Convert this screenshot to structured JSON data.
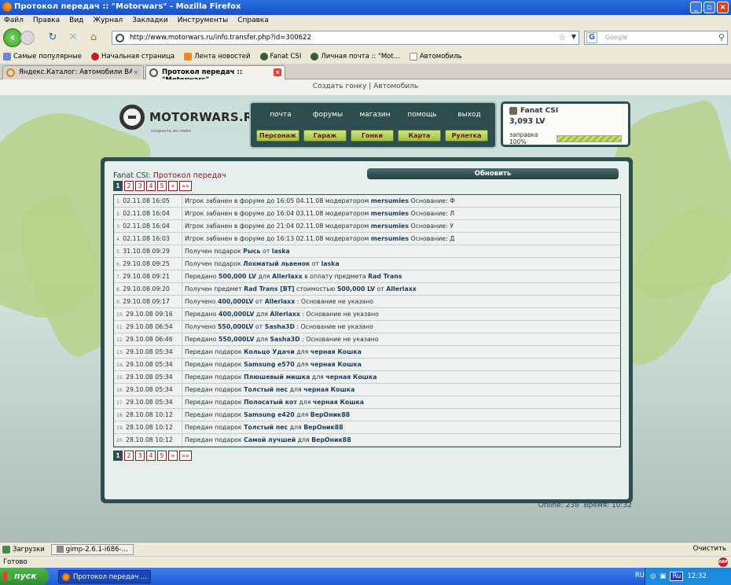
{
  "window": {
    "title": "Протокол передач :: \"Motorwars\" - Mozilla Firefox"
  },
  "menu": [
    "Файл",
    "Правка",
    "Вид",
    "Журнал",
    "Закладки",
    "Инструменты",
    "Справка"
  ],
  "nav": {
    "url": "http://www.motorwars.ru/info.transfer.php?id=300622",
    "search_placeholder": "Google"
  },
  "bookmarks": [
    "Самые популярные",
    "Начальная страница",
    "Лента новостей",
    "Fanat CSI",
    "Личная почта :: \"Mot...",
    "Автомобиль"
  ],
  "tabs": [
    {
      "label": "Яндекс.Каталог: Автомобили ВАЗ",
      "active": false
    },
    {
      "label": "Протокол передач :: \"Motorwars\"",
      "active": true
    }
  ],
  "site": {
    "top_links": "Создать гонку | Автомобиль",
    "logo_text": "MOTORWARS.RU",
    "logo_sub": "скорость он-лайн",
    "nav_top": [
      "почта",
      "форумы",
      "магазин",
      "помощь",
      "выход"
    ],
    "nav_buttons": [
      "Персонаж",
      "Гараж",
      "Гонки",
      "Карта",
      "Рулетка"
    ],
    "user": {
      "name": "Fanat CSI",
      "lv": "3,093 LV",
      "fuel_label": "заправка 100%",
      "fuel": 1.0
    },
    "panel_user": "Fanat CSI",
    "panel_title": ": Протокол передач",
    "refresh": "Обновить",
    "pages": [
      "1",
      "2",
      "3",
      "4",
      "5",
      "»",
      "»»"
    ],
    "online": "Online: 238",
    "time": "Время: 10:32"
  },
  "log": [
    {
      "n": "1.",
      "date": "02.11.08 16:05",
      "pre": "Игрок забанен в форуме до 16:05 04.11.08 модератором ",
      "b1": "mersumies",
      "post": " Основание: Ф"
    },
    {
      "n": "2.",
      "date": "02.11.08 16:04",
      "pre": "Игрок забанен в форуме до 16:04 03.11.08 модератором ",
      "b1": "mersumies",
      "post": " Основание: Л"
    },
    {
      "n": "3.",
      "date": "02.11.08 16:04",
      "pre": "Игрок забанен в форуме до 21:04 02.11.08 модератором ",
      "b1": "mersumies",
      "post": " Основание: У"
    },
    {
      "n": "4.",
      "date": "02.11.08 16:03",
      "pre": "Игрок забанен в форуме до 16:13 02.11.08 модератором ",
      "b1": "mersumies",
      "post": " Основание: Д"
    },
    {
      "n": "5.",
      "date": "31.10.08 09:29",
      "pre": "Получен подарок ",
      "b1": "Рысь",
      "post": " от ",
      "b2": "laska"
    },
    {
      "n": "6.",
      "date": "29.10.08 09:25",
      "pre": "Получен подарок ",
      "b1": "Лохматый львенок",
      "post": " от ",
      "b2": "laska"
    },
    {
      "n": "7.",
      "date": "29.10.08 09:21",
      "pre": "Передано ",
      "b1": "500,000 LV",
      "post": " для ",
      "b2": "Allerlaxx",
      "post2": " в оплату предмета ",
      "b3": "Rad Trans"
    },
    {
      "n": "8.",
      "date": "29.10.08 09:20",
      "pre": "Получен предмет ",
      "b1": "Rad Trans [BT]",
      "post": " стоимостью ",
      "b2": "500,000 LV",
      "post2": " от ",
      "b3": "Allerlaxx"
    },
    {
      "n": "9.",
      "date": "29.10.08 09:17",
      "pre": "Получено ",
      "b1": "400,000LV",
      "post": " от ",
      "b2": "Allerlaxx",
      "post2": " : Основание не указано"
    },
    {
      "n": "10.",
      "date": "29.10.08 09:16",
      "pre": "Передано ",
      "b1": "400,000LV",
      "post": " для ",
      "b2": "Allerlaxx",
      "post2": " : Основание не указано"
    },
    {
      "n": "11.",
      "date": "29.10.08 06:54",
      "pre": "Получено ",
      "b1": "550,000LV",
      "post": " от ",
      "b2": "Sasha3D",
      "post2": " : Основание не указано"
    },
    {
      "n": "12.",
      "date": "29.10.08 06:46",
      "pre": "Передано ",
      "b1": "550,000LV",
      "post": " для ",
      "b2": "Sasha3D",
      "post2": " : Основание не указано"
    },
    {
      "n": "13.",
      "date": "29.10.08 05:34",
      "pre": "Передан подарок ",
      "b1": "Кольцо Удачи",
      "post": " для ",
      "b2": "черная Кошка"
    },
    {
      "n": "14.",
      "date": "29.10.08 05:34",
      "pre": "Передан подарок ",
      "b1": "Samsung e570",
      "post": " для ",
      "b2": "черная Кошка"
    },
    {
      "n": "15.",
      "date": "29.10.08 05:34",
      "pre": "Передан подарок ",
      "b1": "Плюшевый мишка",
      "post": " для ",
      "b2": "черная Кошка"
    },
    {
      "n": "16.",
      "date": "29.10.08 05:34",
      "pre": "Передан подарок ",
      "b1": "Толстый пес",
      "post": " для ",
      "b2": "черная Кошка"
    },
    {
      "n": "17.",
      "date": "29.10.08 05:34",
      "pre": "Передан подарок ",
      "b1": "Полосатый кот",
      "post": " для ",
      "b2": "черная Кошка"
    },
    {
      "n": "18.",
      "date": "28.10.08 10:12",
      "pre": "Передан подарок ",
      "b1": "Samsung e420",
      "post": " для ",
      "b2": "ВерОник88"
    },
    {
      "n": "19.",
      "date": "28.10.08 10:12",
      "pre": "Передан подарок ",
      "b1": "Толстый пес",
      "post": " для ",
      "b2": "ВерОник88"
    },
    {
      "n": "20.",
      "date": "28.10.08 10:12",
      "pre": "Передан подарок ",
      "b1": "Самой лучшей",
      "post": " для ",
      "b2": "ВерОник88"
    }
  ],
  "status": {
    "downloads": "Загрузки",
    "gimp": "gimp-2.6.1-i686-...",
    "clear": "Очистить",
    "ready": "Готово",
    "abp": "ABP"
  },
  "taskbar": {
    "start": "пуск",
    "item": "Протокол передач ...",
    "lang": "RU",
    "lang2": "Ru",
    "clock": "12:32"
  }
}
